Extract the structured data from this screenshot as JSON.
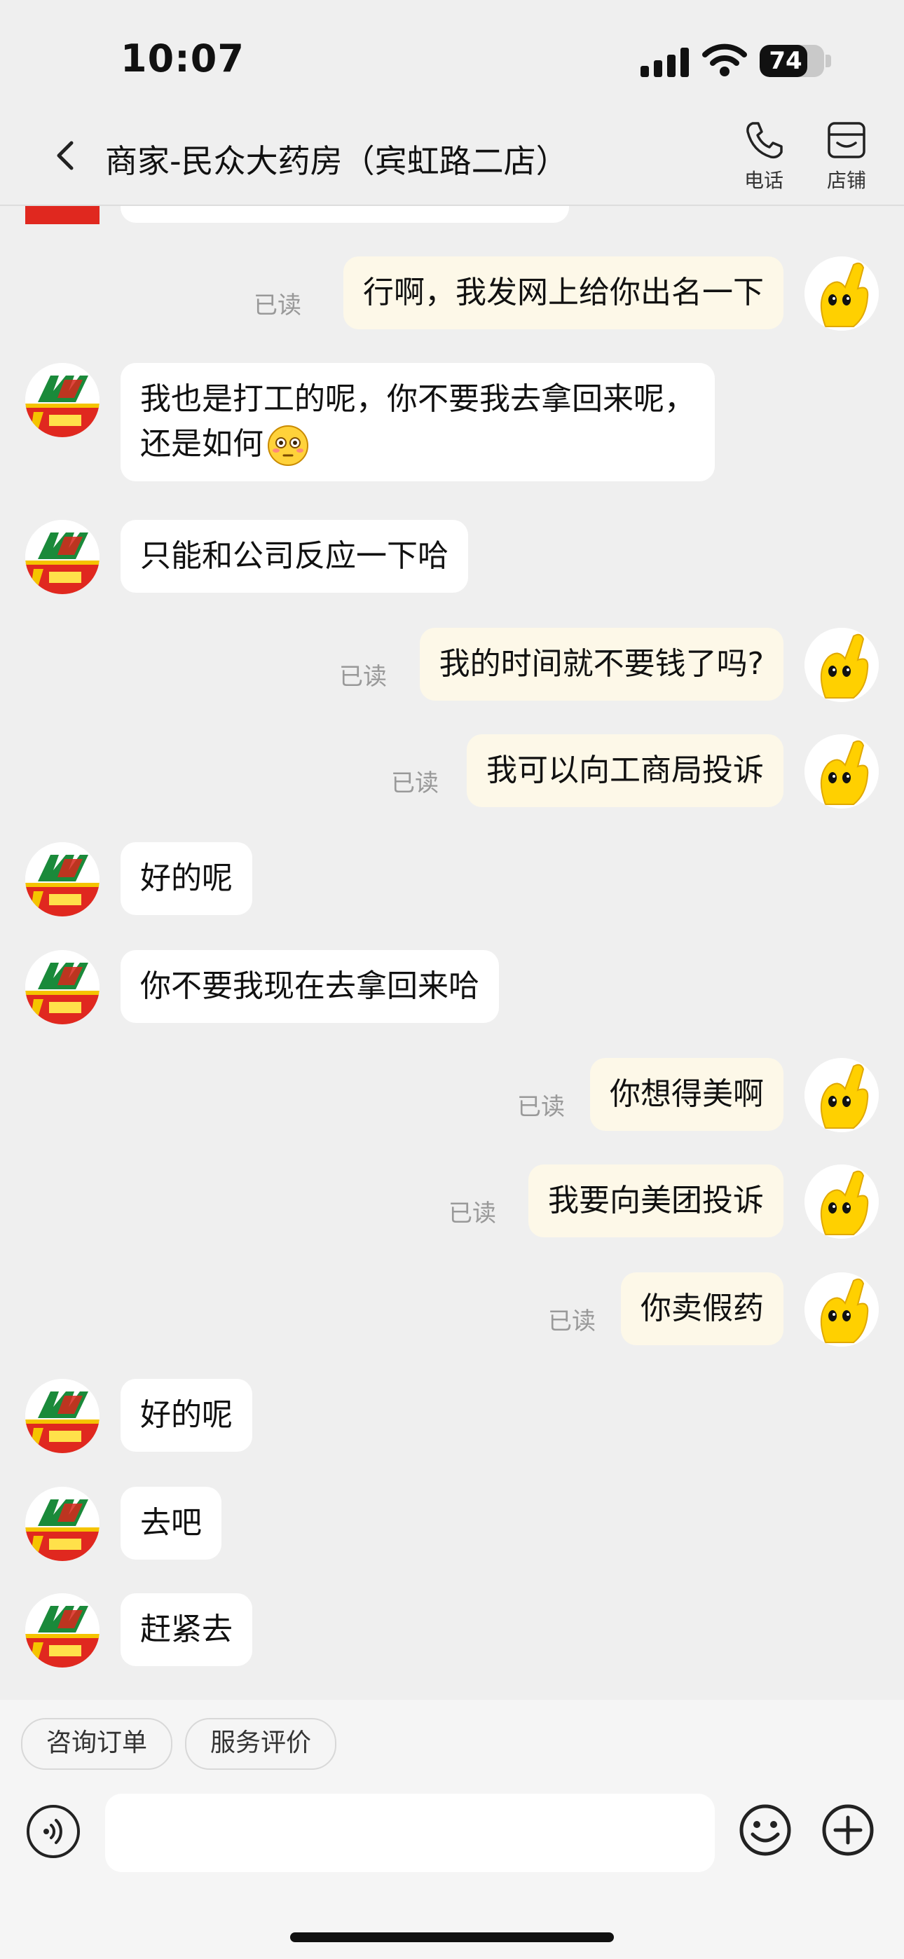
{
  "status_bar": {
    "time": "10:07",
    "battery": "74",
    "battery_level": 0.74
  },
  "header": {
    "title": "商家-民众大药房（宾虹路二店）",
    "phone_label": "电话",
    "shop_label": "店铺"
  },
  "messages": [
    {
      "side": "out",
      "text": "行啊，我发网上给你出名一下",
      "status": "已读"
    },
    {
      "side": "in",
      "lines": [
        "我也是打工的呢，你不要我去拿回来呢，",
        "还是如何"
      ],
      "emoji": "flushed-emoji"
    },
    {
      "side": "in",
      "text": "只能和公司反应一下哈"
    },
    {
      "side": "out",
      "text": "我的时间就不要钱了吗?",
      "status": "已读"
    },
    {
      "side": "out",
      "text": "我可以向工商局投诉",
      "status": "已读"
    },
    {
      "side": "in",
      "text": "好的呢"
    },
    {
      "side": "in",
      "text": "你不要我现在去拿回来哈"
    },
    {
      "side": "out",
      "text": "你想得美啊",
      "status": "已读"
    },
    {
      "side": "out",
      "text": "我要向美团投诉",
      "status": "已读"
    },
    {
      "side": "out",
      "text": "你卖假药",
      "status": "已读"
    },
    {
      "side": "in",
      "text": "好的呢"
    },
    {
      "side": "in",
      "text": "去吧"
    },
    {
      "side": "in",
      "text": "赶紧去"
    }
  ],
  "quick_actions": {
    "consult": "咨询订单",
    "review": "服务评价"
  },
  "input": {
    "placeholder": ""
  },
  "colors": {
    "background": "#efefef",
    "incoming_bubble": "#ffffff",
    "outgoing_bubble": "#fdf8e8",
    "read_status": "#999999"
  }
}
